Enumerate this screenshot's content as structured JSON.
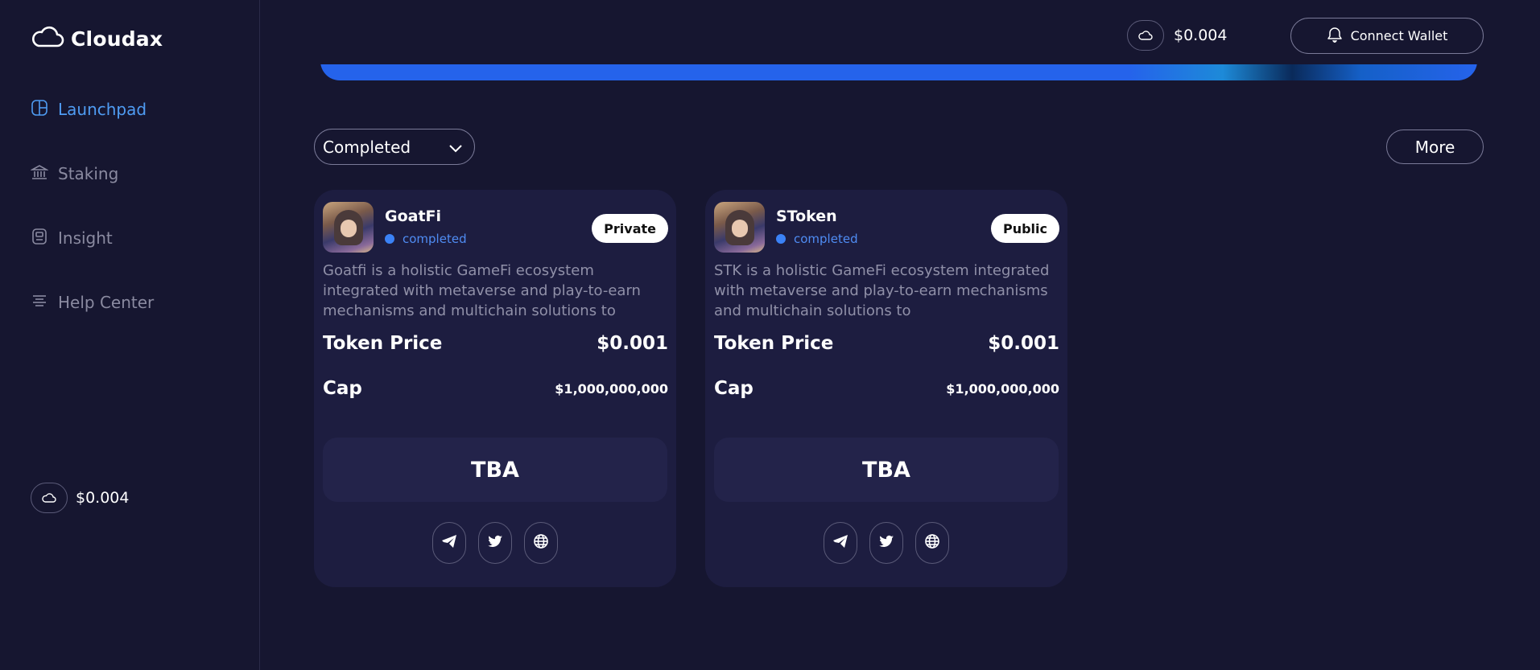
{
  "app": {
    "name": "Cloudax"
  },
  "sidebar": {
    "items": [
      {
        "label": "Launchpad",
        "icon": "launchpad-icon",
        "active": true
      },
      {
        "label": "Staking",
        "icon": "bank-icon",
        "active": false
      },
      {
        "label": "Insight",
        "icon": "insight-icon",
        "active": false
      },
      {
        "label": "Help Center",
        "icon": "help-center-icon",
        "active": false
      }
    ],
    "token_price": "$0.004"
  },
  "header": {
    "token_price": "$0.004",
    "connect_label": "Connect Wallet"
  },
  "filter": {
    "selected": "Completed"
  },
  "more_label": "More",
  "cards": [
    {
      "name": "GoatFi",
      "status": "completed",
      "badge": "Private",
      "description": "Goatfi is a holistic GameFi ecosystem integrated with metaverse and play-to-earn mechanisms and multichain solutions to",
      "price_label": "Token Price",
      "price_value": "$0.001",
      "cap_label": "Cap",
      "cap_value": "$1,000,000,000",
      "action_label": "TBA"
    },
    {
      "name": "SToken",
      "status": "completed",
      "badge": "Public",
      "description": "STK is a holistic GameFi ecosystem integrated with metaverse and play-to-earn mechanisms and multichain solutions to",
      "price_label": "Token Price",
      "price_value": "$0.001",
      "cap_label": "Cap",
      "cap_value": "$1,000,000,000",
      "action_label": "TBA"
    }
  ],
  "colors": {
    "background": "#161630",
    "card": "#1d1d40",
    "accent": "#4f9cf3",
    "status_dot": "#3b82f6"
  }
}
